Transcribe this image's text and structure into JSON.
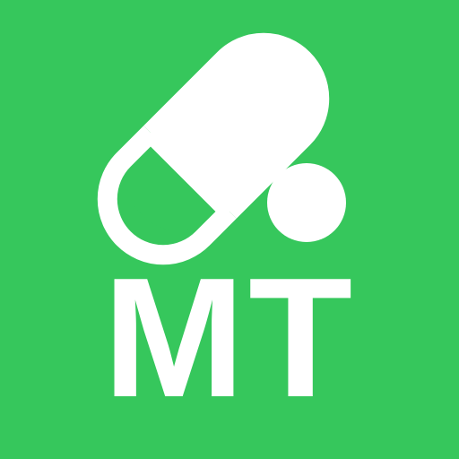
{
  "app_icon": {
    "monogram": "MT",
    "colors": {
      "background": "#36C75C",
      "foreground": "#FFFFFF"
    },
    "icons": [
      "capsule-pill-icon",
      "round-tablet-icon"
    ]
  }
}
